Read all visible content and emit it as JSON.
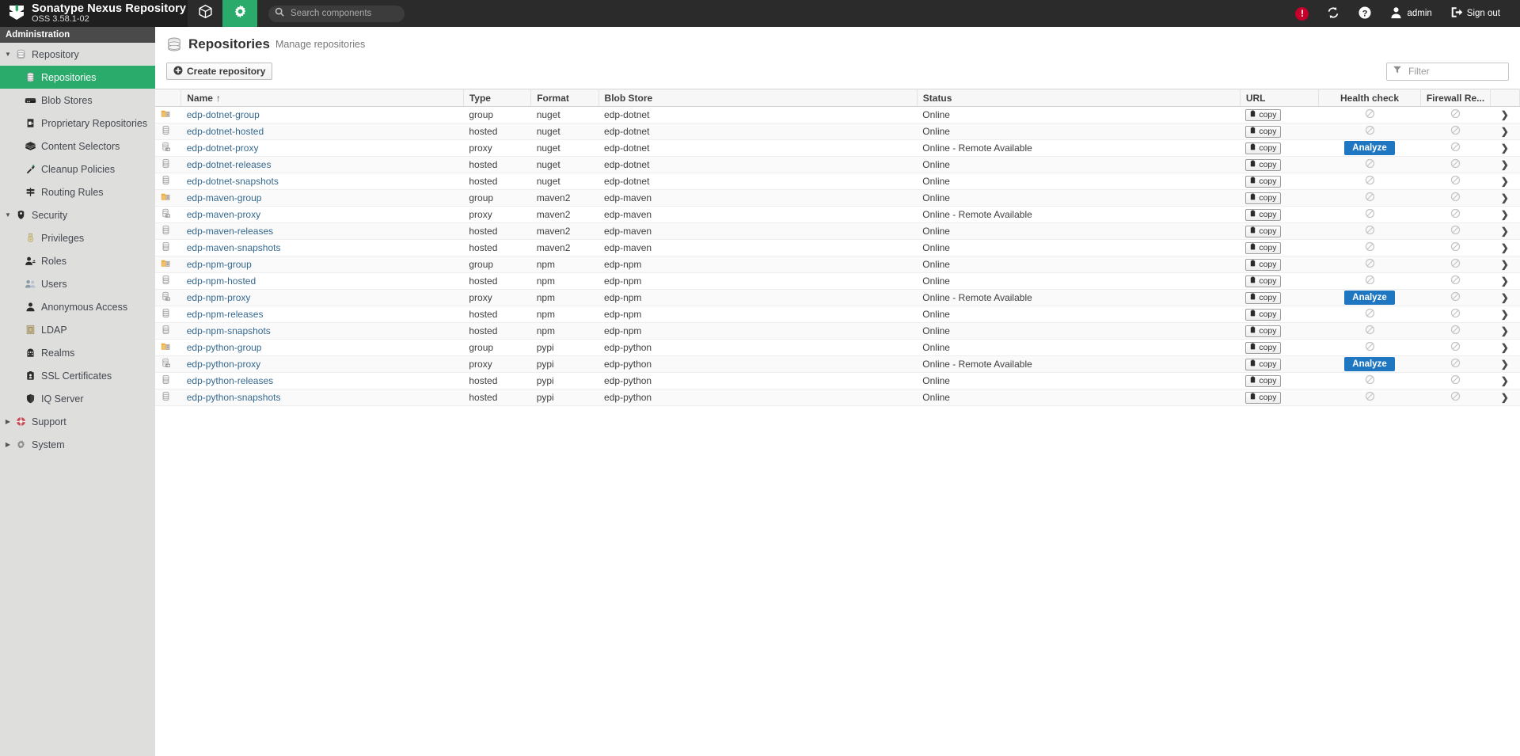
{
  "brand": {
    "title": "Sonatype Nexus Repository",
    "version": "OSS 3.58.1-02",
    "logo_icon": "nexus-chevron-logo"
  },
  "topnav": {
    "items": [
      {
        "icon": "cube-browse-icon",
        "name": "browse",
        "active": false
      },
      {
        "icon": "gear-admin-icon",
        "name": "administration",
        "active": true
      }
    ],
    "search": {
      "placeholder": "Search components",
      "value": "",
      "icon": "search-icon"
    },
    "right": [
      {
        "name": "alert-indicator",
        "icon": "alert-exclamation-icon",
        "label": "!",
        "color": "#c4002b"
      },
      {
        "name": "refresh-button",
        "icon": "refresh-sync-icon",
        "label": ""
      },
      {
        "name": "help-button",
        "icon": "help-question-icon",
        "label": ""
      },
      {
        "name": "user-menu",
        "icon": "user-avatar-icon",
        "label": "admin"
      },
      {
        "name": "sign-out-button",
        "icon": "sign-out-icon",
        "label": "Sign out"
      }
    ]
  },
  "sidebar": {
    "header": "Administration",
    "selected": "Repositories",
    "items": [
      {
        "label": "Repository",
        "icon": "database-icon",
        "level": "group",
        "caret": "down"
      },
      {
        "label": "Repositories",
        "icon": "repository-icon",
        "level": "child",
        "selected": true
      },
      {
        "label": "Blob Stores",
        "icon": "blob-store-icon",
        "level": "child"
      },
      {
        "label": "Proprietary Repositories",
        "icon": "proprietary-icon",
        "level": "child"
      },
      {
        "label": "Content Selectors",
        "icon": "layers-icon",
        "level": "child"
      },
      {
        "label": "Cleanup Policies",
        "icon": "broom-icon",
        "level": "child"
      },
      {
        "label": "Routing Rules",
        "icon": "signpost-icon",
        "level": "child"
      },
      {
        "label": "Security",
        "icon": "shield-security-icon",
        "level": "group",
        "caret": "down"
      },
      {
        "label": "Privileges",
        "icon": "medal-icon",
        "level": "child"
      },
      {
        "label": "Roles",
        "icon": "user-role-icon",
        "level": "child"
      },
      {
        "label": "Users",
        "icon": "users-icon",
        "level": "child"
      },
      {
        "label": "Anonymous Access",
        "icon": "anonymous-user-icon",
        "level": "child"
      },
      {
        "label": "LDAP",
        "icon": "ldap-book-icon",
        "level": "child"
      },
      {
        "label": "Realms",
        "icon": "realms-icon",
        "level": "child"
      },
      {
        "label": "SSL Certificates",
        "icon": "certificate-icon",
        "level": "child"
      },
      {
        "label": "IQ Server",
        "icon": "iq-shield-icon",
        "level": "child"
      },
      {
        "label": "Support",
        "icon": "life-ring-icon",
        "level": "group",
        "caret": "right"
      },
      {
        "label": "System",
        "icon": "system-gear-icon",
        "level": "group",
        "caret": "right"
      }
    ]
  },
  "page": {
    "icon": "repositories-db-icon",
    "title": "Repositories",
    "subtitle": "Manage repositories"
  },
  "toolbar": {
    "create_label": "Create repository",
    "create_icon": "plus-circle-icon",
    "filter": {
      "placeholder": "Filter",
      "value": "",
      "icon": "funnel-filter-icon"
    }
  },
  "table": {
    "columns": [
      {
        "key": "icon",
        "label": ""
      },
      {
        "key": "name",
        "label": "Name",
        "sort": "asc",
        "sort_glyph": "↑"
      },
      {
        "key": "type",
        "label": "Type"
      },
      {
        "key": "format",
        "label": "Format"
      },
      {
        "key": "blob",
        "label": "Blob Store"
      },
      {
        "key": "status",
        "label": "Status"
      },
      {
        "key": "url",
        "label": "URL"
      },
      {
        "key": "health",
        "label": "Health check"
      },
      {
        "key": "firewall",
        "label": "Firewall Re..."
      },
      {
        "key": "chevron",
        "label": ""
      }
    ],
    "copy_label": "copy",
    "copy_icon": "clipboard-copy-icon",
    "analyze_label": "Analyze",
    "disabled_icon": "prohibited-circle-icon",
    "row_chevron_icon": "chevron-right-icon",
    "rows": [
      {
        "name": "edp-dotnet-group",
        "type": "group",
        "format": "nuget",
        "blob": "edp-dotnet",
        "status": "Online",
        "health": "disabled",
        "firewall": "disabled"
      },
      {
        "name": "edp-dotnet-hosted",
        "type": "hosted",
        "format": "nuget",
        "blob": "edp-dotnet",
        "status": "Online",
        "health": "disabled",
        "firewall": "disabled"
      },
      {
        "name": "edp-dotnet-proxy",
        "type": "proxy",
        "format": "nuget",
        "blob": "edp-dotnet",
        "status": "Online - Remote Available",
        "health": "analyze",
        "firewall": "disabled"
      },
      {
        "name": "edp-dotnet-releases",
        "type": "hosted",
        "format": "nuget",
        "blob": "edp-dotnet",
        "status": "Online",
        "health": "disabled",
        "firewall": "disabled"
      },
      {
        "name": "edp-dotnet-snapshots",
        "type": "hosted",
        "format": "nuget",
        "blob": "edp-dotnet",
        "status": "Online",
        "health": "disabled",
        "firewall": "disabled"
      },
      {
        "name": "edp-maven-group",
        "type": "group",
        "format": "maven2",
        "blob": "edp-maven",
        "status": "Online",
        "health": "disabled",
        "firewall": "disabled"
      },
      {
        "name": "edp-maven-proxy",
        "type": "proxy",
        "format": "maven2",
        "blob": "edp-maven",
        "status": "Online - Remote Available",
        "health": "disabled",
        "firewall": "disabled"
      },
      {
        "name": "edp-maven-releases",
        "type": "hosted",
        "format": "maven2",
        "blob": "edp-maven",
        "status": "Online",
        "health": "disabled",
        "firewall": "disabled"
      },
      {
        "name": "edp-maven-snapshots",
        "type": "hosted",
        "format": "maven2",
        "blob": "edp-maven",
        "status": "Online",
        "health": "disabled",
        "firewall": "disabled"
      },
      {
        "name": "edp-npm-group",
        "type": "group",
        "format": "npm",
        "blob": "edp-npm",
        "status": "Online",
        "health": "disabled",
        "firewall": "disabled"
      },
      {
        "name": "edp-npm-hosted",
        "type": "hosted",
        "format": "npm",
        "blob": "edp-npm",
        "status": "Online",
        "health": "disabled",
        "firewall": "disabled"
      },
      {
        "name": "edp-npm-proxy",
        "type": "proxy",
        "format": "npm",
        "blob": "edp-npm",
        "status": "Online - Remote Available",
        "health": "analyze",
        "firewall": "disabled"
      },
      {
        "name": "edp-npm-releases",
        "type": "hosted",
        "format": "npm",
        "blob": "edp-npm",
        "status": "Online",
        "health": "disabled",
        "firewall": "disabled"
      },
      {
        "name": "edp-npm-snapshots",
        "type": "hosted",
        "format": "npm",
        "blob": "edp-npm",
        "status": "Online",
        "health": "disabled",
        "firewall": "disabled"
      },
      {
        "name": "edp-python-group",
        "type": "group",
        "format": "pypi",
        "blob": "edp-python",
        "status": "Online",
        "health": "disabled",
        "firewall": "disabled"
      },
      {
        "name": "edp-python-proxy",
        "type": "proxy",
        "format": "pypi",
        "blob": "edp-python",
        "status": "Online - Remote Available",
        "health": "analyze",
        "firewall": "disabled"
      },
      {
        "name": "edp-python-releases",
        "type": "hosted",
        "format": "pypi",
        "blob": "edp-python",
        "status": "Online",
        "health": "disabled",
        "firewall": "disabled"
      },
      {
        "name": "edp-python-snapshots",
        "type": "hosted",
        "format": "pypi",
        "blob": "edp-python",
        "status": "Online",
        "health": "disabled",
        "firewall": "disabled"
      }
    ]
  },
  "colors": {
    "accent_green": "#2aab6b",
    "topbar": "#2b2b2b",
    "brand_bg": "#1f1f1f",
    "sidebar_bg": "#dededd",
    "link_blue": "#36698f",
    "analyze_blue": "#1f77c2",
    "alert_red": "#c4002b"
  }
}
